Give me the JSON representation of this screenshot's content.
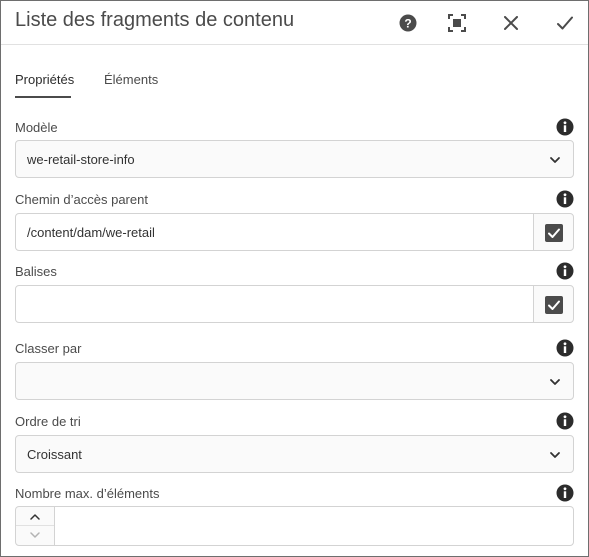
{
  "dialog": {
    "title": "Liste des fragments de contenu",
    "actions": [
      "help-icon",
      "fullscreen-icon",
      "close-icon",
      "done-icon"
    ]
  },
  "tabs": [
    {
      "label": "Propriétés",
      "active": true
    },
    {
      "label": "Éléments",
      "active": false
    }
  ],
  "fields": {
    "model": {
      "label": "Modèle",
      "value": "we-retail-store-info"
    },
    "parent_path": {
      "label": "Chemin d’accès parent",
      "value": "/content/dam/we-retail"
    },
    "tags": {
      "label": "Balises",
      "value": ""
    },
    "order_by": {
      "label": "Classer par",
      "value": ""
    },
    "sort_order": {
      "label": "Ordre de tri",
      "value": "Croissant"
    },
    "max_items": {
      "label": "Nombre max. d’éléments",
      "value": ""
    }
  },
  "colors": {
    "text": "#323232",
    "border": "#d3d3d3",
    "field_bg": "#fafafa",
    "icon": "#4b4b4b"
  }
}
